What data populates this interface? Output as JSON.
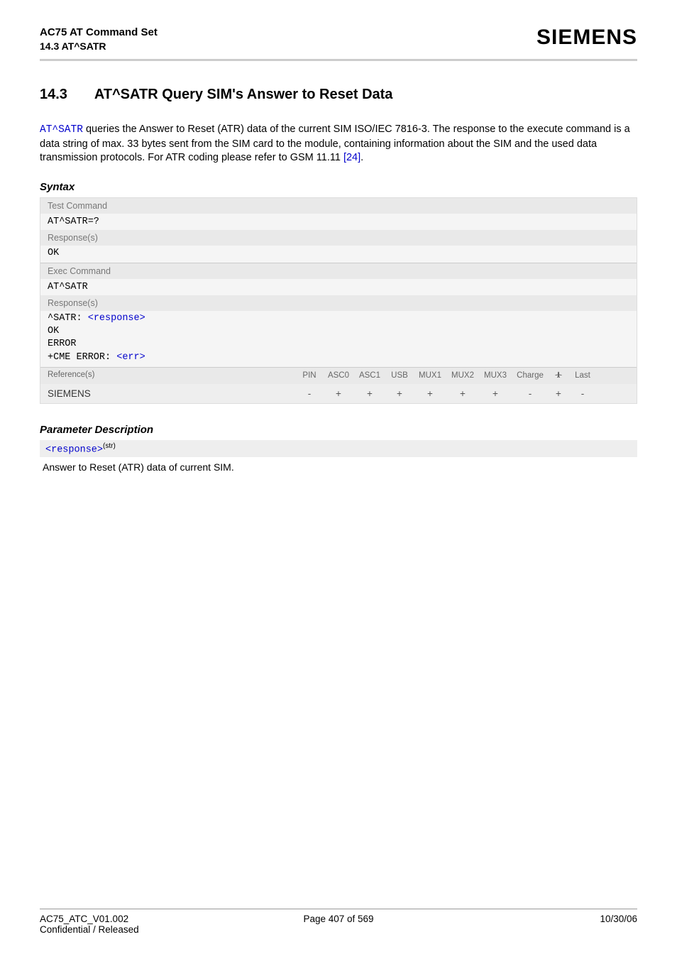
{
  "header": {
    "title": "AC75 AT Command Set",
    "subtitle": "14.3 AT^SATR",
    "brand": "SIEMENS"
  },
  "section": {
    "number": "14.3",
    "title": "AT^SATR   Query SIM's Answer to Reset Data"
  },
  "intro": {
    "cmd": "AT^SATR",
    "text_after_cmd": " queries the Answer to Reset (ATR) data of the current SIM ISO/IEC 7816-3. The response to the execute command is a data string of max. 33 bytes sent from the SIM card to the module, containing information about the SIM and the used data transmission protocols. For ATR coding please refer to GSM 11.11 ",
    "ref_link": "[24]",
    "period": "."
  },
  "syntax": {
    "heading": "Syntax",
    "test_label": "Test Command",
    "test_cmd": "AT^SATR=?",
    "test_resp_label": "Response(s)",
    "test_resp": "OK",
    "exec_label": "Exec Command",
    "exec_cmd": "AT^SATR",
    "exec_resp_label": "Response(s)",
    "exec_resp_prefix": "^SATR: ",
    "exec_resp_param": "<response>",
    "exec_resp_lines": [
      "OK",
      "ERROR",
      "+CME ERROR: "
    ],
    "exec_resp_err_param": "<err>",
    "ref_label": "Reference(s)",
    "ref_value": "SIEMENS",
    "cols": [
      "PIN",
      "ASC0",
      "ASC1",
      "USB",
      "MUX1",
      "MUX2",
      "MUX3",
      "Charge",
      "",
      "Last"
    ],
    "vals": [
      "-",
      "+",
      "+",
      "+",
      "+",
      "+",
      "+",
      "-",
      "+",
      "-"
    ]
  },
  "param": {
    "heading": "Parameter Description",
    "name": "<response>",
    "type": "(str)",
    "desc": "Answer to Reset (ATR) data of current SIM."
  },
  "footer": {
    "left1": "AC75_ATC_V01.002",
    "left2": "Confidential / Released",
    "center": "Page 407 of 569",
    "right": "10/30/06"
  }
}
